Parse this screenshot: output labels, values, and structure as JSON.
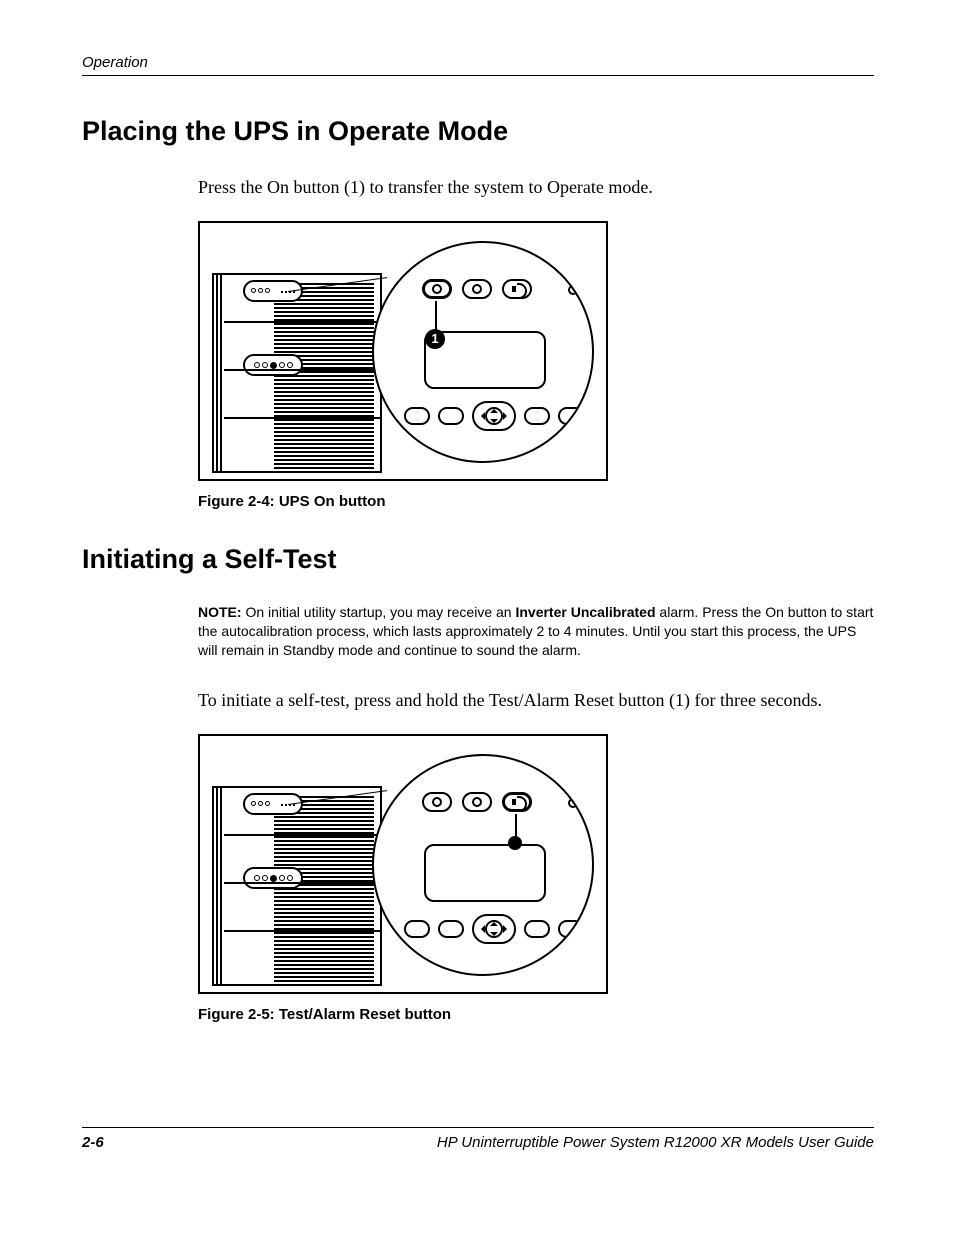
{
  "running_head": "Operation",
  "section1": {
    "heading": "Placing the UPS in Operate Mode",
    "body": "Press the On button (1) to transfer the system to Operate mode.",
    "caption": "Figure 2-4:  UPS On button",
    "callout": "1"
  },
  "section2": {
    "heading": "Initiating a Self-Test",
    "note_label": "NOTE:",
    "note_pre": "  On initial utility startup, you may receive an ",
    "note_bold": "Inverter Uncalibrated",
    "note_post": " alarm. Press the On button to start the autocalibration process, which lasts approximately 2 to 4 minutes. Until you start this process, the UPS will remain in Standby mode and continue to sound the alarm.",
    "body": "To initiate a self-test, press and hold the Test/Alarm Reset button (1) for three seconds.",
    "caption": "Figure 2-5:  Test/Alarm Reset button"
  },
  "footer": {
    "page": "2-6",
    "title": "HP Uninterruptible Power System R12000 XR Models User Guide"
  }
}
